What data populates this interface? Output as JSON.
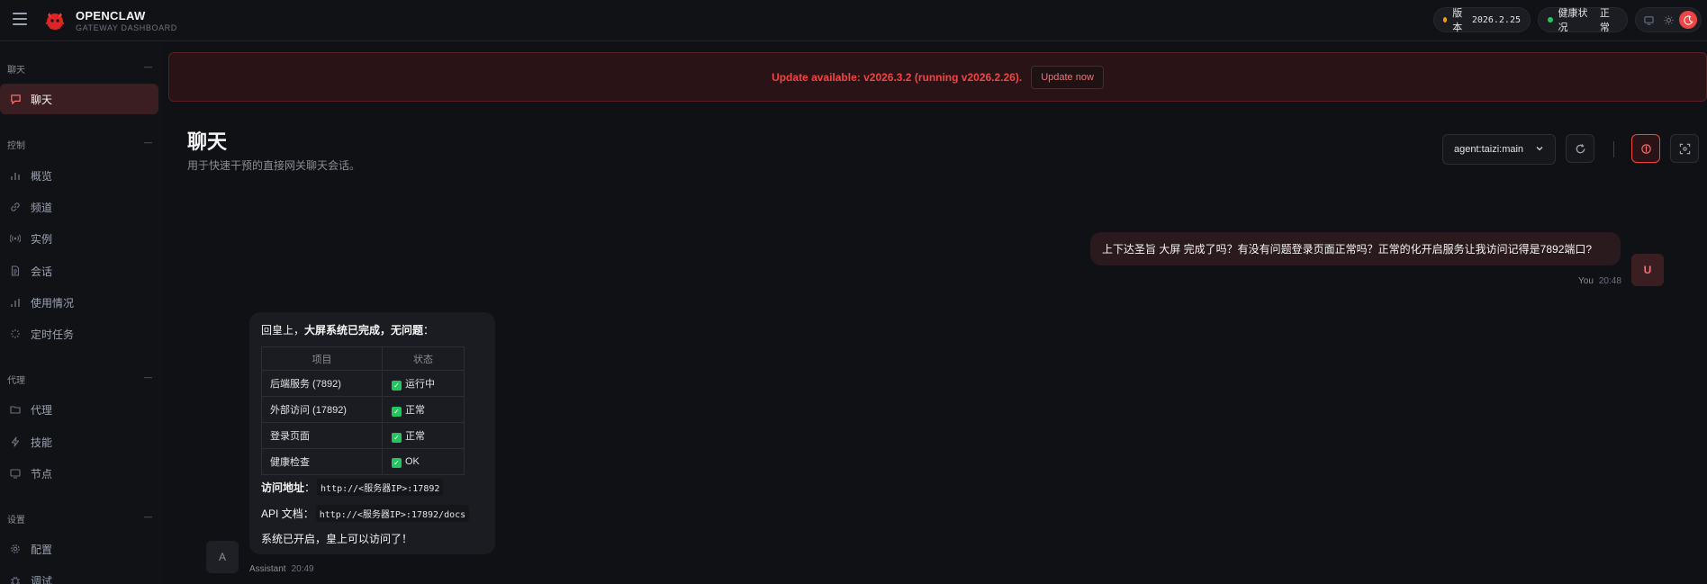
{
  "header": {
    "brand_title": "OPENCLAW",
    "brand_subtitle": "GATEWAY DASHBOARD",
    "version_label": "版本",
    "version_value": "2026.2.25",
    "health_label": "健康状况",
    "health_value": "正常",
    "accent_color": "#ef4444"
  },
  "sidebar": {
    "sections": [
      {
        "label": "聊天",
        "items": [
          {
            "label": "聊天",
            "icon": "chat-bubble-icon",
            "active": true
          }
        ]
      },
      {
        "label": "控制",
        "items": [
          {
            "label": "概览",
            "icon": "bar-chart-icon"
          },
          {
            "label": "频道",
            "icon": "link-icon"
          },
          {
            "label": "实例",
            "icon": "broadcast-icon"
          },
          {
            "label": "会话",
            "icon": "document-icon"
          },
          {
            "label": "使用情况",
            "icon": "bar-chart-icon"
          },
          {
            "label": "定时任务",
            "icon": "loader-icon"
          }
        ]
      },
      {
        "label": "代理",
        "items": [
          {
            "label": "代理",
            "icon": "folder-icon"
          },
          {
            "label": "技能",
            "icon": "lightning-icon"
          },
          {
            "label": "节点",
            "icon": "monitor-icon"
          }
        ]
      },
      {
        "label": "设置",
        "items": [
          {
            "label": "配置",
            "icon": "gear-icon"
          },
          {
            "label": "调试",
            "icon": "bug-icon"
          }
        ]
      }
    ]
  },
  "banner": {
    "text": "Update available: v2026.3.2 (running v2026.2.26).",
    "button": "Update now"
  },
  "page": {
    "title": "聊天",
    "subtitle": "用于快速干预的直接网关聊天会话。",
    "agent_select": "agent:taizi:main"
  },
  "messages": {
    "user": {
      "text": "上下达圣旨 大屏 完成了吗？有没有问题登录页面正常吗？正常的化开启服务让我访问记得是7892端口?",
      "avatar": "U",
      "sender": "You",
      "time": "20:48"
    },
    "assistant": {
      "intro_prefix": "回皇上，",
      "intro_bold": "大屏系统已完成，无问题",
      "intro_suffix": "：",
      "table_headers": [
        "项目",
        "状态"
      ],
      "rows": [
        {
          "item": "后端服务 (7892)",
          "status": "运行中"
        },
        {
          "item": "外部访问 (17892)",
          "status": "正常"
        },
        {
          "item": "登录页面",
          "status": "正常"
        },
        {
          "item": "健康检查",
          "status": "OK"
        }
      ],
      "access_label": "访问地址",
      "access_url": "http://<服务器IP>:17892",
      "api_label": "API 文档",
      "api_url": "http://<服务器IP>:17892/docs",
      "closing": "系统已开启，皇上可以访问了！",
      "avatar": "A",
      "sender": "Assistant",
      "time": "20:49"
    }
  }
}
